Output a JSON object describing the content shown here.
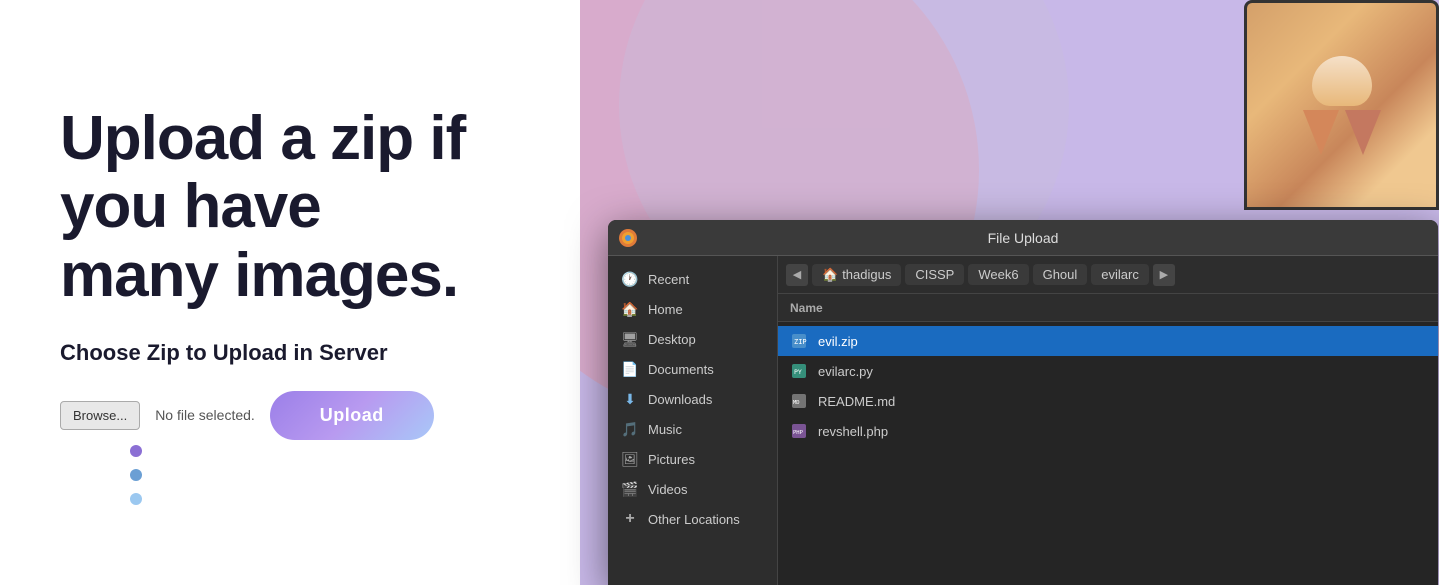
{
  "page": {
    "heading_line1": "Upload a zip if you have",
    "heading_line2": "many images.",
    "sub_heading": "Choose Zip to Upload in Server",
    "browse_label": "Browse...",
    "no_file_text": "No file selected.",
    "upload_label": "Upload"
  },
  "dialog": {
    "title": "File Upload",
    "breadcrumbs": [
      "thadigus",
      "CISSP",
      "Week6",
      "Ghoul",
      "evilarc"
    ],
    "column_name": "Name",
    "sidebar": {
      "items": [
        {
          "id": "recent",
          "label": "Recent",
          "icon": "🕐"
        },
        {
          "id": "home",
          "label": "Home",
          "icon": "🏠"
        },
        {
          "id": "desktop",
          "label": "Desktop",
          "icon": "🖥"
        },
        {
          "id": "documents",
          "label": "Documents",
          "icon": "📄"
        },
        {
          "id": "downloads",
          "label": "Downloads",
          "icon": "⬇"
        },
        {
          "id": "music",
          "label": "Music",
          "icon": "🎵"
        },
        {
          "id": "pictures",
          "label": "Pictures",
          "icon": "🖼"
        },
        {
          "id": "videos",
          "label": "Videos",
          "icon": "🎬"
        },
        {
          "id": "other",
          "label": "Other Locations",
          "icon": "+"
        }
      ]
    },
    "files": [
      {
        "name": "evil.zip",
        "type": "zip",
        "selected": true
      },
      {
        "name": "evilarc.py",
        "type": "py",
        "selected": false
      },
      {
        "name": "README.md",
        "type": "md",
        "selected": false
      },
      {
        "name": "revshell.php",
        "type": "php",
        "selected": false
      }
    ]
  },
  "icons": {
    "back": "◀",
    "forward": "▶",
    "home_breadcrumb": "🏠"
  }
}
